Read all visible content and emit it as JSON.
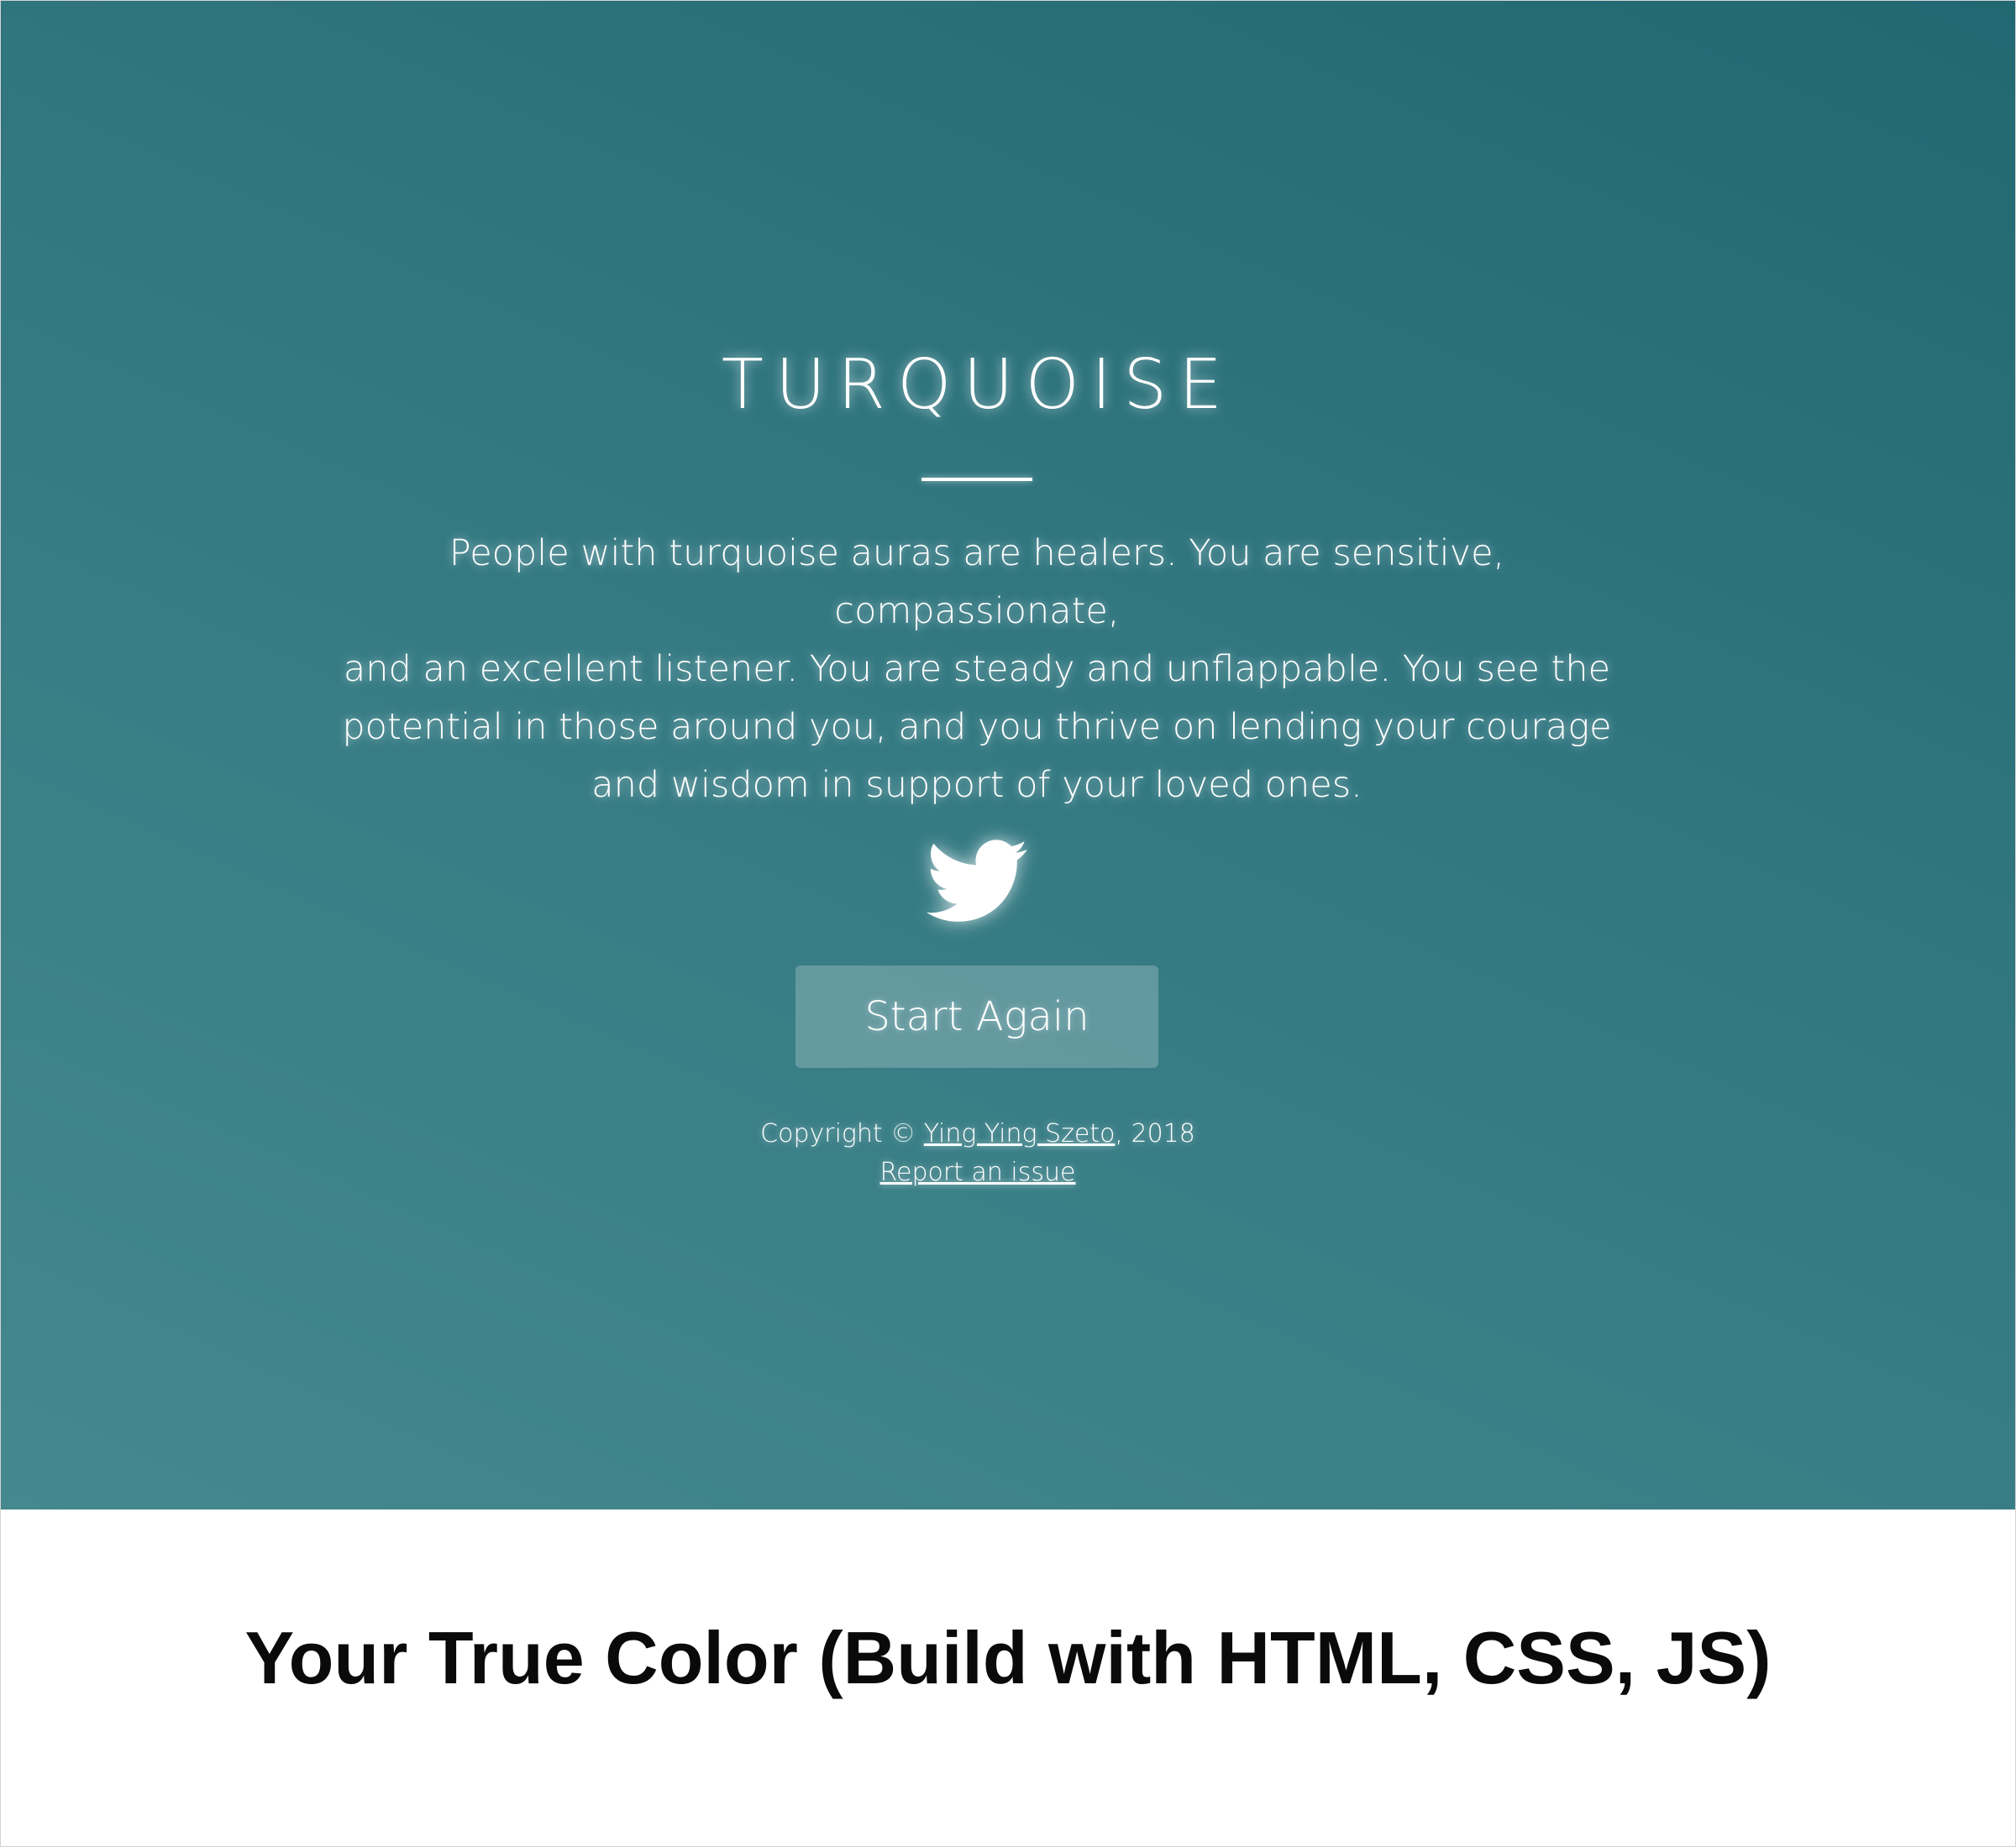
{
  "result": {
    "title": "TURQUOISE",
    "description_lines": [
      "People with turquoise auras are healers. You are sensitive, compassionate,",
      "and an excellent listener. You are steady and unflappable. You see the",
      "potential in those around you, and you thrive on lending your courage",
      "and wisdom in support of your loved ones."
    ],
    "share_icon": "twitter-bird-icon"
  },
  "actions": {
    "start_again_label": "Start Again"
  },
  "footer": {
    "copyright_prefix": "Copyright © ",
    "author_link": "Ying Ying Szeto",
    "copyright_suffix": ", 2018",
    "report_link": "Report an issue"
  },
  "caption": {
    "text": "Your True Color (Build with HTML, CSS, JS)"
  },
  "colors": {
    "gradient_light": "#45888e",
    "gradient_dark": "#216873",
    "text": "#ffffff",
    "caption_text": "#0a0a0a"
  }
}
